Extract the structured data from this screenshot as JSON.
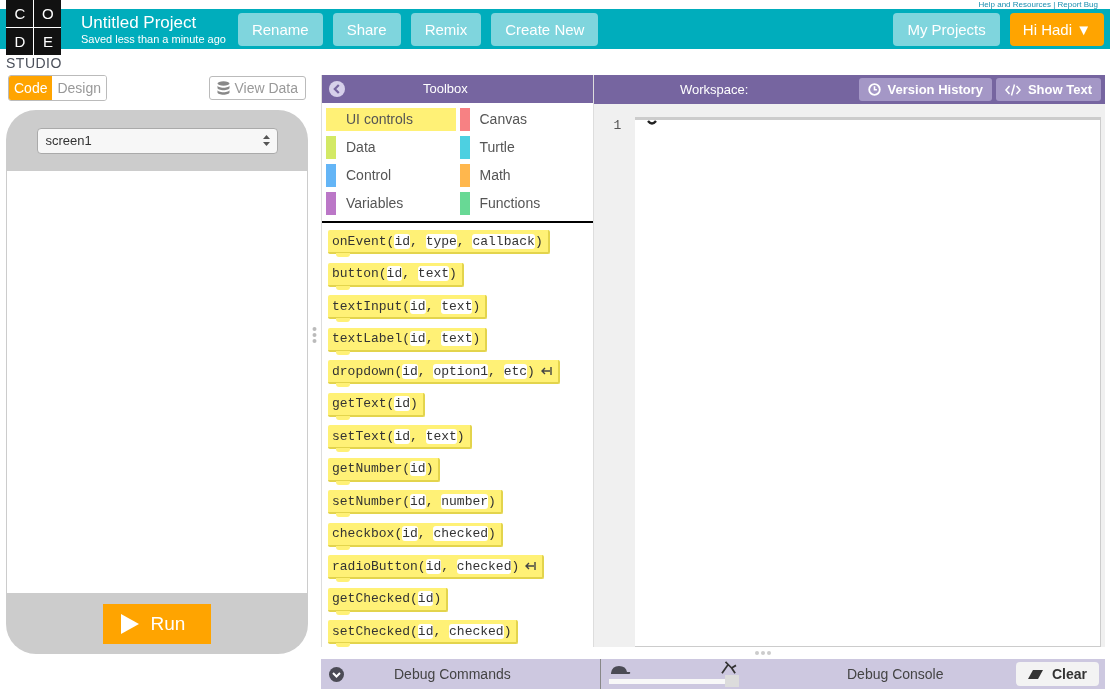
{
  "help_links": "Help and Resources | Report Bug",
  "logo": {
    "letters": [
      "C",
      "O",
      "D",
      "E"
    ],
    "caption": "STUDIO"
  },
  "project": {
    "title": "Untitled Project",
    "status": "Saved less than a minute ago"
  },
  "header_buttons": [
    "Rename",
    "Share",
    "Remix",
    "Create New"
  ],
  "account_buttons": [
    {
      "label": "My Projects",
      "kind": "plain"
    },
    {
      "label": "Hi Hadi ▼",
      "kind": "accent"
    }
  ],
  "mode_toggle": [
    {
      "label": "Code",
      "selected": true
    },
    {
      "label": "Design",
      "selected": false
    }
  ],
  "view_data": "View Data",
  "screen_select": "screen1",
  "run_button": "Run",
  "toolbox": {
    "title": "Toolbox",
    "categories": [
      {
        "label": "UI controls",
        "color": "#fff176",
        "selected": true
      },
      {
        "label": "Canvas",
        "color": "#f78183",
        "selected": false
      },
      {
        "label": "Data",
        "color": "#d3e965",
        "selected": false
      },
      {
        "label": "Turtle",
        "color": "#4dd0e1",
        "selected": false
      },
      {
        "label": "Control",
        "color": "#64b5f6",
        "selected": false
      },
      {
        "label": "Math",
        "color": "#ffb74d",
        "selected": false
      },
      {
        "label": "Variables",
        "color": "#bb77c7",
        "selected": false
      },
      {
        "label": "Functions",
        "color": "#68d995",
        "selected": false
      }
    ],
    "blocks": [
      {
        "parts": [
          "onEvent(",
          "id",
          ", ",
          "type",
          ", ",
          "callback",
          ")"
        ],
        "expand": false
      },
      {
        "parts": [
          "button(",
          "id",
          ", ",
          "text",
          ")"
        ],
        "expand": false
      },
      {
        "parts": [
          "textInput(",
          "id",
          ", ",
          "text",
          ")"
        ],
        "expand": false
      },
      {
        "parts": [
          "textLabel(",
          "id",
          ", ",
          "text",
          ")"
        ],
        "expand": false
      },
      {
        "parts": [
          "dropdown(",
          "id",
          ", ",
          "option1",
          ", ",
          "etc",
          ")"
        ],
        "expand": true
      },
      {
        "parts": [
          "getText(",
          "id",
          ")"
        ],
        "expand": false
      },
      {
        "parts": [
          "setText(",
          "id",
          ", ",
          "text",
          ")"
        ],
        "expand": false
      },
      {
        "parts": [
          "getNumber(",
          "id",
          ")"
        ],
        "expand": false
      },
      {
        "parts": [
          "setNumber(",
          "id",
          ", ",
          "number",
          ")"
        ],
        "expand": false
      },
      {
        "parts": [
          "checkbox(",
          "id",
          ", ",
          "checked",
          ")"
        ],
        "expand": false
      },
      {
        "parts": [
          "radioButton(",
          "id",
          ", ",
          "checked",
          ")"
        ],
        "expand": true
      },
      {
        "parts": [
          "getChecked(",
          "id",
          ")"
        ],
        "expand": false
      },
      {
        "parts": [
          "setChecked(",
          "id",
          ", ",
          "checked",
          ")"
        ],
        "expand": false
      }
    ]
  },
  "workspace": {
    "title": "Workspace:",
    "buttons": [
      {
        "label": "Version History",
        "kind": "history"
      },
      {
        "label": "Show Text",
        "kind": "code"
      }
    ],
    "line_numbers": [
      "1"
    ]
  },
  "debug": {
    "commands_label": "Debug Commands",
    "console_label": "Debug Console",
    "speed": {
      "level": 0.96
    },
    "clear_button": "Clear"
  }
}
